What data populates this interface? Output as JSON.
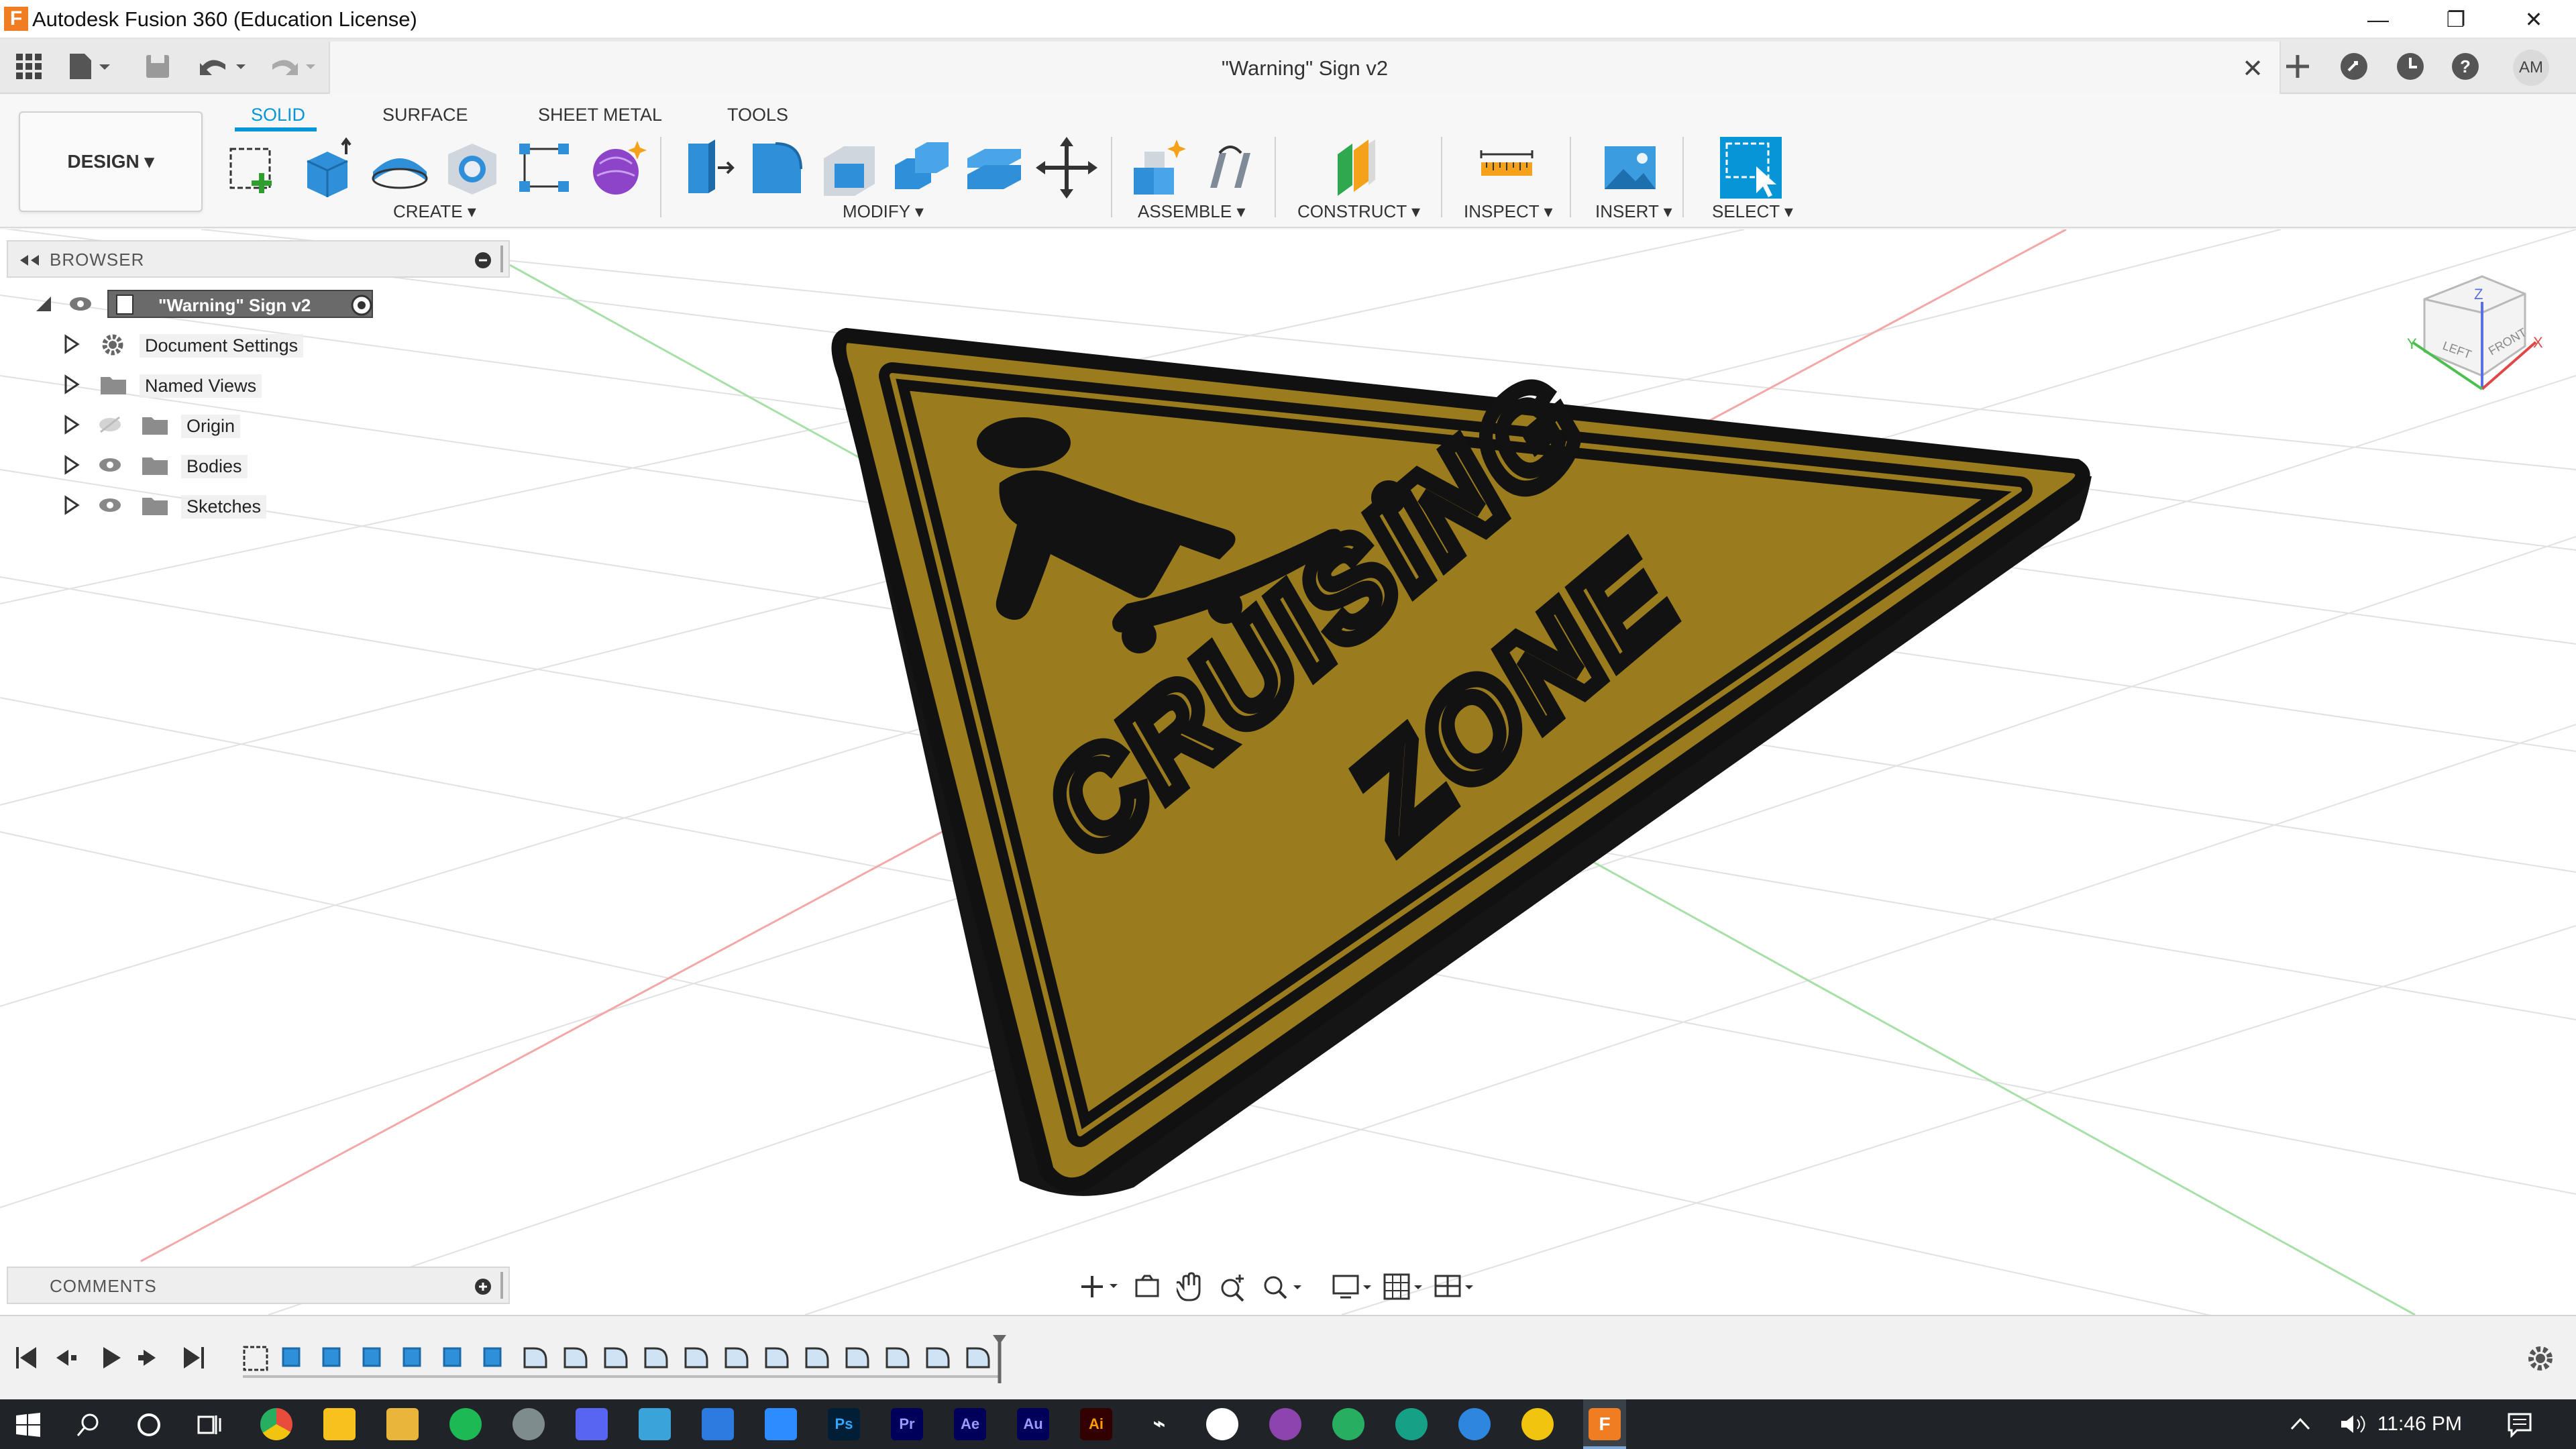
{
  "window": {
    "title": "Autodesk Fusion 360 (Education License)",
    "app_icon_letter": "F",
    "minimize": "—",
    "restore": "❐",
    "close": "✕"
  },
  "document_tab": {
    "title": "\"Warning\" Sign v2",
    "close": "✕"
  },
  "user": {
    "initials": "AM"
  },
  "ribbon": {
    "workspace": "DESIGN ▾",
    "tabs": [
      "SOLID",
      "SURFACE",
      "SHEET METAL",
      "TOOLS"
    ],
    "active_tab": "SOLID",
    "groups": {
      "create": "CREATE ▾",
      "modify": "MODIFY ▾",
      "assemble": "ASSEMBLE ▾",
      "construct": "CONSTRUCT ▾",
      "inspect": "INSPECT ▾",
      "insert": "INSERT ▾",
      "select": "SELECT ▾"
    }
  },
  "browser": {
    "title": "BROWSER",
    "root": "\"Warning\" Sign v2",
    "items": [
      {
        "label": "Document Settings",
        "icon": "gear-icon"
      },
      {
        "label": "Named Views",
        "icon": "folder-icon"
      },
      {
        "label": "Origin",
        "icon": "folder-icon"
      },
      {
        "label": "Bodies",
        "icon": "folder-icon"
      },
      {
        "label": "Sketches",
        "icon": "folder-icon"
      }
    ]
  },
  "comments": {
    "title": "COMMENTS"
  },
  "model": {
    "line1": "CRUISING",
    "line2": "ZONE",
    "sign_color": "#9a7c1e",
    "border_color": "#111111"
  },
  "viewcube": {
    "left": "LEFT",
    "front": "FRONT",
    "z": "Z",
    "x": "X",
    "y": "Y"
  },
  "taskbar": {
    "apps": [
      "Ps",
      "Pr",
      "Ae",
      "Au",
      "Ai"
    ],
    "time": "11:46 PM"
  },
  "colors": {
    "accent": "#0696d7",
    "taskbar": "#202428",
    "fusion_orange": "#f07d21"
  }
}
